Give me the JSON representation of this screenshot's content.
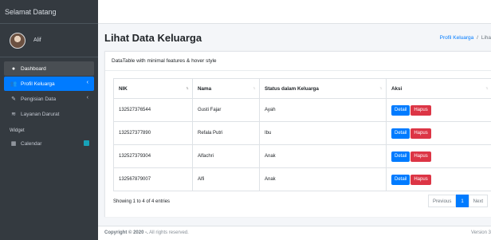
{
  "sidebar": {
    "brand": "Selamat Datang",
    "user_name": "Alif",
    "items": [
      {
        "label": "Dashboard",
        "icon": "dashboard-icon",
        "glyph": "●"
      },
      {
        "label": "Profil Keluarga",
        "icon": "users-icon",
        "glyph": "👥"
      },
      {
        "label": "Pengisian Data",
        "icon": "edit-icon",
        "glyph": "✎"
      },
      {
        "label": "Layanan Darurat",
        "icon": "wifi-icon",
        "glyph": "≋"
      }
    ],
    "section_header": "Widget",
    "calendar": {
      "label": "Calendar",
      "icon": "calendar-icon",
      "glyph": "▦"
    }
  },
  "content": {
    "title": "Lihat Data Keluarga",
    "breadcrumb": {
      "link": "Profil Keluarga",
      "separator": "/",
      "current": "Liha"
    }
  },
  "card": {
    "header": "DataTable with minimal features & hover style",
    "columns": [
      "NIK",
      "Nama",
      "Status dalam Keluarga",
      "Aksi"
    ],
    "rows": [
      {
        "nik": "132527376544",
        "nama": "Gusti Fajar",
        "status": "Ayah"
      },
      {
        "nik": "132527377890",
        "nama": "Refala Putri",
        "status": "Ibu"
      },
      {
        "nik": "132527379304",
        "nama": "Alfachri",
        "status": "Anak"
      },
      {
        "nik": "132567879007",
        "nama": "Alfi",
        "status": "Anak"
      }
    ],
    "detail_label": "Detail",
    "hapus_label": "Hapus",
    "info": "Showing 1 to 4 of 4 entries",
    "pagination": {
      "previous": "Previous",
      "current": "1",
      "next": "Next"
    }
  },
  "footer": {
    "copyright": "Copyright © 2020 -.",
    "rights": " All rights reserved.",
    "version": "Version 3"
  },
  "colors": {
    "sidebar_bg": "#343a40",
    "accent": "#007bff",
    "danger": "#dc3545"
  }
}
